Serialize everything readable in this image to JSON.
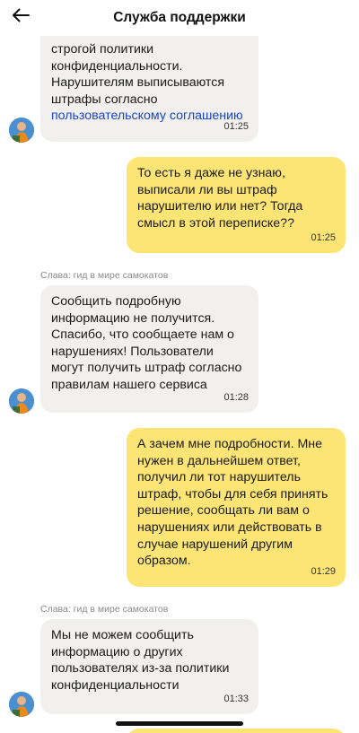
{
  "header": {
    "title": "Служба поддержки",
    "back_icon": "arrow-left-icon"
  },
  "colors": {
    "incoming_bubble": "#f1f0ef",
    "outgoing_bubble": "#fce575",
    "link": "#1a46c8"
  },
  "messages": [
    {
      "direction": "incoming",
      "text": "строгой политики\nконфиденциальности.\nНарушителям выписываются\nштрафы согласно",
      "link_text": "пользовательскому соглашению",
      "time": "01:25"
    },
    {
      "direction": "outgoing",
      "text": "То есть я даже не узнаю,\nвыписали ли вы штраф\nнарушителю или нет? Тогда\nсмысл в этой переписке??",
      "time": "01:25"
    },
    {
      "direction": "incoming",
      "sender": "Слава: гид в мире самокатов",
      "text": "Сообщить подробную\nинформацию не получится.\nСпасибо, что сообщаете нам о\nнарушениях! Пользователи\nмогут получить штраф согласно\nправилам нашего сервиса",
      "time": "01:28"
    },
    {
      "direction": "outgoing",
      "text": "А зачем мне подробности. Мне\nнужен в дальнейшем ответ,\nполучил ли тот нарушитель\nштраф, чтобы для себя принять\nрешение, сообщать ли вам о\nнарушениях или действовать в\nслучае нарушений другим\nобразом.",
      "time": "01:29"
    },
    {
      "direction": "incoming",
      "sender": "Слава: гид в мире самокатов",
      "text": "Мы не можем сообщить\nинформацию о других\nпользователях из-за политики\nконфиденциальности",
      "time": "01:33"
    }
  ]
}
